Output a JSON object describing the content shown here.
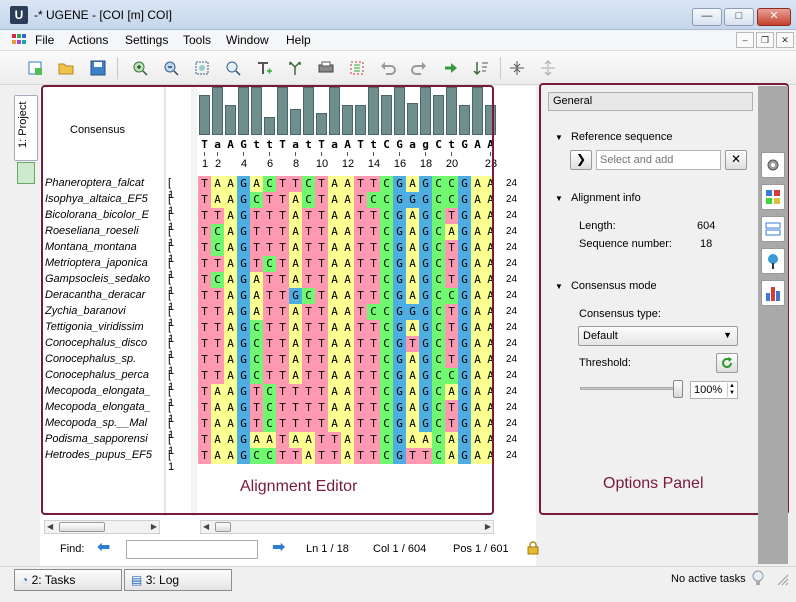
{
  "window": {
    "title": "-* UGENE - [COI [m] COI]",
    "logo_letter": "U",
    "min_symbol": "—",
    "max_symbol": "□",
    "close_symbol": "✕"
  },
  "menu": [
    "File",
    "Actions",
    "Settings",
    "Tools",
    "Window",
    "Help"
  ],
  "mdi_buttons": [
    "–",
    "❐",
    "✕"
  ],
  "toolbar_icons": [
    "new-document-icon",
    "open-folder-icon",
    "save-icon",
    "zoom-in-icon",
    "zoom-out-icon",
    "zoom-to-selection-icon",
    "reset-zoom-icon",
    "add-text-icon",
    "build-tree-icon",
    "print-icon",
    "select-region-icon",
    "undo-icon",
    "redo-icon",
    "go-right-icon",
    "sort-icon",
    "collapse-icon",
    "expand-icon"
  ],
  "left_panel": {
    "project_tab": "1: Project"
  },
  "alignment": {
    "consensus_label": "Consensus",
    "consensus": "TaAGttTatTaATtCGagCtGAA",
    "ruler": [
      "1",
      "2",
      "4",
      "6",
      "8",
      "10",
      "12",
      "14",
      "16",
      "18",
      "20",
      "23"
    ],
    "histogram": [
      40,
      48,
      30,
      48,
      48,
      18,
      48,
      26,
      48,
      22,
      48,
      30,
      30,
      48,
      40,
      48,
      32,
      48,
      40,
      48,
      30,
      48,
      30
    ],
    "rows": [
      {
        "name": "Phaneroptera_falcat",
        "bracket": "[",
        "len_prefix": "1",
        "seq": "TAAGACTTCTAATTCGAGCCGAA",
        "len": "24"
      },
      {
        "name": "Isophya_altaica_EF5",
        "bracket": "[",
        "len_prefix": "1",
        "seq": "TAAGCTTACTAATCCGGGCCGAA",
        "len": "24"
      },
      {
        "name": "Bicolorana_bicolor_E",
        "bracket": "[",
        "len_prefix": "1",
        "seq": "TTAGTTTATTAATTCGAGCTGAA",
        "len": "24"
      },
      {
        "name": "Roeseliana_roeseli",
        "bracket": "[",
        "len_prefix": "1",
        "seq": "TCAGTTTATTAATTCGAGCAGAA",
        "len": "24"
      },
      {
        "name": "Montana_montana",
        "bracket": "[",
        "len_prefix": "1",
        "seq": "TCAGTTTATTAATTCGAGCTGAA",
        "len": "24"
      },
      {
        "name": "Metrioptera_japonica",
        "bracket": "[",
        "len_prefix": "1",
        "seq": "TTAGTCTATTAATTCGAGCTGAA",
        "len": "24"
      },
      {
        "name": "Gampsocleis_sedako",
        "bracket": "[",
        "len_prefix": "1",
        "seq": "TCAGATTATTAATTCGAGCTGAA",
        "len": "24"
      },
      {
        "name": "Deracantha_deracar",
        "bracket": "[",
        "len_prefix": "1",
        "seq": "TTAGATTGCTAATTCGAGCCGAA",
        "len": "24"
      },
      {
        "name": "Zychia_baranovi",
        "bracket": "[",
        "len_prefix": "1",
        "seq": "TTAGATTATTAATCCGGGCTGAA",
        "len": "24"
      },
      {
        "name": "Tettigonia_viridissim",
        "bracket": "[",
        "len_prefix": "1",
        "seq": "TTAGCTTATTAATTCGAGCTGAA",
        "len": "24"
      },
      {
        "name": "Conocephalus_disco",
        "bracket": "[",
        "len_prefix": "1",
        "seq": "TTAGCTTATTAATTCGTGCTGAA",
        "len": "24"
      },
      {
        "name": "Conocephalus_sp.",
        "bracket": "[",
        "len_prefix": "1",
        "seq": "TTAGCTTATTAATTCGAGCTGAA",
        "len": "24"
      },
      {
        "name": "Conocephalus_perca",
        "bracket": "[",
        "len_prefix": "1",
        "seq": "TTAGCTTATTAATTCGAGCCGAA",
        "len": "24"
      },
      {
        "name": "Mecopoda_elongata_",
        "bracket": "[",
        "len_prefix": "1",
        "seq": "TAAGTCTTTTAATTCGAGCAGAA",
        "len": "24"
      },
      {
        "name": "Mecopoda_elongata_",
        "bracket": "[",
        "len_prefix": "1",
        "seq": "TAAGTCTTTTAATTCGAGCTGAA",
        "len": "24"
      },
      {
        "name": "Mecopoda_sp.__Mal",
        "bracket": "[",
        "len_prefix": "1",
        "seq": "TAAGTCTTTTAATTCGAGCTGAA",
        "len": "24"
      },
      {
        "name": "Podisma_sapporensi",
        "bracket": "[",
        "len_prefix": "1",
        "seq": "TAAGAATAATTATTCGAACAGAA",
        "len": "24"
      },
      {
        "name": "Hetrodes_pupus_EF5",
        "bracket": "[",
        "len_prefix": "1",
        "seq": "TAAGCCTTATTATTCGTTCAGAA",
        "len": "24"
      }
    ],
    "colors": {
      "A": "#fcff92",
      "C": "#70f970",
      "G": "#4eade1",
      "T": "#ff99b1"
    },
    "caption": "Alignment Editor"
  },
  "find_bar": {
    "label": "Find:",
    "value": "",
    "ln": "Ln 1 / 18",
    "col": "Col 1 / 604",
    "pos": "Pos 1 / 601"
  },
  "options": {
    "general": "General",
    "reference_sequence": {
      "title": "Reference sequence",
      "placeholder": "Select and add",
      "go_symbol": "❯",
      "clear_symbol": "✕"
    },
    "alignment_info": {
      "title": "Alignment info",
      "length_label": "Length:",
      "length": "604",
      "seqnum_label": "Sequence number:",
      "seqnum": "18"
    },
    "consensus_mode": {
      "title": "Consensus mode",
      "type_label": "Consensus type:",
      "type_value": "Default",
      "threshold_label": "Threshold:",
      "threshold_percent": 100,
      "threshold_value": "100%"
    },
    "caption": "Options Panel",
    "side_tab_icons": [
      "settings-icon",
      "color-scheme-icon",
      "pairwise-alignment-icon",
      "tree-settings-icon",
      "statistics-icon"
    ]
  },
  "bottom": {
    "tasks_tab": "2: Tasks",
    "log_tab": "3: Log",
    "status": "No active tasks"
  },
  "accent_color": "#7a1a3b"
}
